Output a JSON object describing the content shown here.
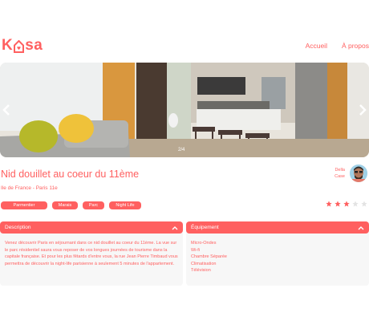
{
  "header": {
    "logo_prefix": "K",
    "logo_suffix": "sa",
    "nav": [
      {
        "label": "Accueil"
      },
      {
        "label": "À propos"
      }
    ]
  },
  "gallery": {
    "counter": "2/4"
  },
  "listing": {
    "title": "Nid douillet au coeur du 11ème",
    "location": "Ile de France - Paris 11e",
    "host": {
      "first_name": "Della",
      "last_name": "Case"
    },
    "tags": [
      "Parmentier",
      "Marais",
      "Parc",
      "Night Life"
    ],
    "rating": 3,
    "rating_max": 5
  },
  "colors": {
    "accent": "#FF6060",
    "panel": "#F7F7F7",
    "star_off": "#E3E3E3"
  },
  "description": {
    "title": "Description",
    "text": "Venez découvrir Paris en séjournant dans ce nid douillet au coeur du 11ème. La vue sur le parc résidentiel saura vous reposer de vos longues journées de tourisme dans la capitale française. Et pour les plus fêtards d'entre vous, la rue Jean Pierre Timbaud vous permettra de découvrir la night-life parisienne à seulement 5 minutes de l'appartement."
  },
  "equipments": {
    "title": "Équipement",
    "items": [
      "Micro-Ondes",
      "Wi-fi",
      "Chambre Séparée",
      "Climatisation",
      "Télévision"
    ]
  }
}
